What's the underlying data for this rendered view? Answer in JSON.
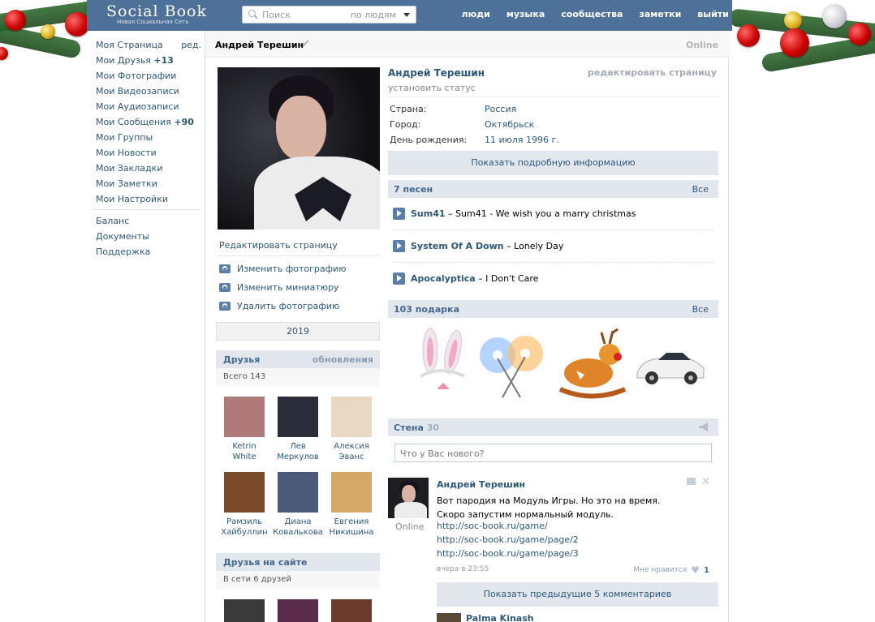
{
  "header": {
    "logo_title": "Social Book",
    "logo_subtitle": "Новая Социальная Сеть",
    "search_placeholder": "Поиск",
    "search_scope": "по людям",
    "nav": [
      "люди",
      "музыка",
      "сообщества",
      "заметки",
      "выйти"
    ]
  },
  "leftmenu": {
    "edit": "ред.",
    "items": [
      {
        "label": "Моя Страница",
        "count": ""
      },
      {
        "label": "Мои Друзья",
        "count": "+13"
      },
      {
        "label": "Мои Фотографии",
        "count": ""
      },
      {
        "label": "Мои Видеозаписи",
        "count": ""
      },
      {
        "label": "Мои Аудиозаписи",
        "count": ""
      },
      {
        "label": "Мои Сообщения",
        "count": "+90"
      },
      {
        "label": "Мои Группы",
        "count": ""
      },
      {
        "label": "Мои Новости",
        "count": ""
      },
      {
        "label": "Мои Закладки",
        "count": ""
      },
      {
        "label": "Мои Заметки",
        "count": ""
      },
      {
        "label": "Мои Настройки",
        "count": ""
      }
    ],
    "extra": [
      "Баланс",
      "Документы",
      "Поддержка"
    ]
  },
  "pagehead": {
    "name": "Андрей Терешин",
    "check": "✔",
    "status": "Online"
  },
  "profile": {
    "edit_page": "Редактировать страницу",
    "photo_actions": [
      "Изменить фотографию",
      "Изменить миниатюру",
      "Удалить фотографию"
    ],
    "year": "2019",
    "friends": {
      "title": "Друзья",
      "updates": "обновления",
      "total": "Всего 143",
      "list": [
        {
          "first": "Ketrin",
          "last": "White"
        },
        {
          "first": "Лев",
          "last": "Меркулов"
        },
        {
          "first": "Алексия",
          "last": "Эванс"
        },
        {
          "first": "Рамзиль",
          "last": "Хайбуллин"
        },
        {
          "first": "Диана",
          "last": "Ковалькова"
        },
        {
          "first": "Евгения",
          "last": "Никишина"
        }
      ]
    },
    "friends_online": {
      "title": "Друзья на сайте",
      "count": "В сети 6 друзей"
    }
  },
  "info": {
    "name": "Андрей Терешин",
    "edit": "редактировать страницу",
    "set_status": "установить статус",
    "rows": [
      {
        "key": "Страна:",
        "value": "Россия"
      },
      {
        "key": "Город:",
        "value": "Октябрьск"
      },
      {
        "key": "День рождения:",
        "value": "11 июля 1996 г."
      }
    ],
    "show_more": "Показать подробную информацию"
  },
  "music": {
    "title": "7 песен",
    "all": "Все",
    "tracks": [
      {
        "artist": "Sum41",
        "title": "– Sum41 - We wish you a marry christmas"
      },
      {
        "artist": "System Of A Down",
        "title": "– Lonely Day"
      },
      {
        "artist": "Apocalyptica",
        "title": "– I Don't Care"
      }
    ]
  },
  "gifts": {
    "title": "103 подарка",
    "all": "Все"
  },
  "wall": {
    "title": "Стена",
    "count": "30",
    "input_placeholder": "Что у Вас нового?",
    "post": {
      "author": "Андрей Терешин",
      "online": "Online",
      "text": "Вот пародия на Модуль Игры. Но это на время. Скоро запустим нормальный модуль.",
      "links": [
        "http://soc-book.ru/game/",
        "http://soc-book.ru/game/page/2",
        "http://soc-book.ru/game/page/3"
      ],
      "date": "вчера в 23:55",
      "like_label": "Мне нравится",
      "like_count": "1"
    },
    "show_previous": "Показать предыдущие 5 комментариев",
    "comment_author": "Palma Kinash"
  },
  "colors": {
    "header_bg": "#4d7198",
    "link": "#2b587a",
    "section_bg": "#e1e7ed"
  }
}
